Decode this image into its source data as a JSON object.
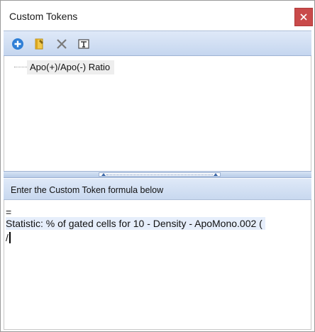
{
  "window": {
    "title": "Custom Tokens",
    "close_symbol": "✕"
  },
  "toolbar": {
    "buttons": [
      {
        "name": "add",
        "icon": "plus-circle-icon",
        "color": "#2f7fd6"
      },
      {
        "name": "edit",
        "icon": "document-edit-icon",
        "color": "#e0b020"
      },
      {
        "name": "delete",
        "icon": "x-delete-icon",
        "color": "#7a7a7a"
      },
      {
        "name": "format",
        "icon": "text-format-icon",
        "color": "#4a4a4a"
      }
    ]
  },
  "tree": {
    "items": [
      {
        "label": "Apo(+)/Apo(-) Ratio"
      }
    ]
  },
  "formula": {
    "header": "Enter the Custom Token formula below",
    "lines": [
      "=",
      "Statistic: % of gated cells for 10 - Density - ApoMono.002 (",
      "/"
    ]
  },
  "colors": {
    "accent": "#c5d6ef",
    "close_button": "#c94a4a",
    "highlight": "#e6eefb"
  }
}
